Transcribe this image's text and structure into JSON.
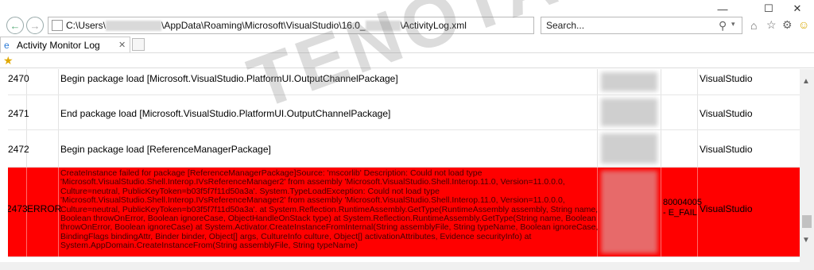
{
  "browser": {
    "address_parts": [
      "C:\\Users\\",
      "\\AppData\\Roaming\\Microsoft\\VisualStudio\\16.0_",
      "\\ActivityLog.xml"
    ],
    "search_placeholder": "Search...",
    "tab_title": "Activity Monitor Log"
  },
  "log_rows": [
    {
      "id": "2470",
      "type": "",
      "description": "Begin package load [Microsoft.VisualStudio.PlatformUI.OutputChannelPackage]",
      "hr": "",
      "app": "VisualStudio"
    },
    {
      "id": "2471",
      "type": "",
      "description": "End package load [Microsoft.VisualStudio.PlatformUI.OutputChannelPackage]",
      "hr": "",
      "app": "VisualStudio"
    },
    {
      "id": "2472",
      "type": "",
      "description": "Begin package load [ReferenceManagerPackage]",
      "hr": "",
      "app": "VisualStudio"
    },
    {
      "id": "2473",
      "type": "ERROR",
      "description": "CreateInstance failed for package [ReferenceManagerPackage]Source: 'mscorlib' Description: Could not load type\n'Microsoft.VisualStudio.Shell.Interop.IVsReferenceManager2' from assembly 'Microsoft.VisualStudio.Shell.Interop.11.0, Version=11.0.0.0,\nCulture=neutral, PublicKeyToken=b03f5f7f11d50a3a'. System.TypeLoadException: Could not load type\n'Microsoft.VisualStudio.Shell.Interop.IVsReferenceManager2' from assembly 'Microsoft.VisualStudio.Shell.Interop.11.0, Version=11.0.0.0,\nCulture=neutral, PublicKeyToken=b03f5f7f11d50a3a'. at System.Reflection.RuntimeAssembly.GetType(RuntimeAssembly assembly, String name,\nBoolean throwOnError, Boolean ignoreCase, ObjectHandleOnStack type) at System.Reflection.RuntimeAssembly.GetType(String name, Boolean\nthrowOnError, Boolean ignoreCase) at System.Activator.CreateInstanceFromInternal(String assemblyFile, String typeName, Boolean ignoreCase,\nBindingFlags bindingAttr, Binder binder, Object[] args, CultureInfo culture, Object[] activationAttributes, Evidence securityInfo) at\nSystem.AppDomain.CreateInstanceFrom(String assemblyFile, String typeName)",
      "hr": "80004005 - E_FAIL",
      "app": "VisualStudio"
    }
  ],
  "watermark": "TENOTA.COM",
  "colors": {
    "error_row": "#ff0000",
    "icon_green": "#5a9"
  },
  "icons": [
    "back-icon",
    "forward-icon",
    "refresh-icon",
    "home-icon",
    "star-icon",
    "gear-icon",
    "smiley-icon"
  ]
}
